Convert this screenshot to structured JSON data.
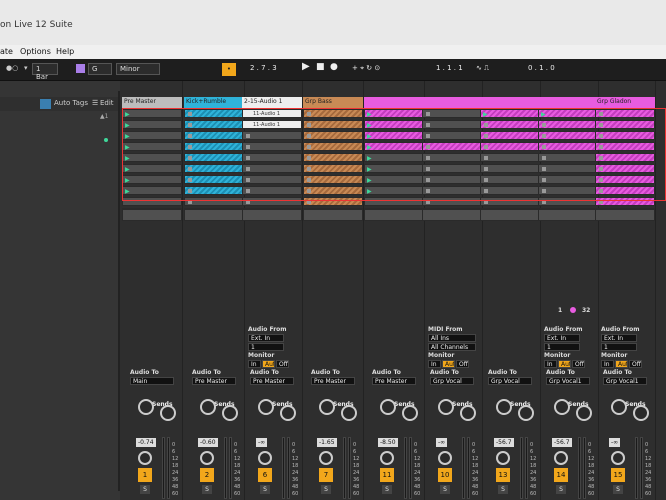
{
  "window": {
    "title": "on Live 12 Suite"
  },
  "menu": {
    "items": [
      "ate",
      "Options",
      "Help"
    ]
  },
  "control_bar": {
    "quantize": "1 Bar",
    "key": "G",
    "scale": "Minor",
    "arrangement_position": "2 . 7 . 3",
    "loop_start": "1 . 1 . 1",
    "loop_length": "0 . 1 . 0"
  },
  "browser": {
    "auto_tags": "Auto Tags",
    "edit": "Edit"
  },
  "tracks": [
    {
      "name": "Pre Master",
      "color": "#bdbdbd",
      "audio_to": "Main",
      "volume": "-0.74",
      "number": "1"
    },
    {
      "name": "Kick+Rumble",
      "color": "#2fb3d9",
      "audio_to": "Pre Master",
      "volume": "-0.60",
      "number": "2"
    },
    {
      "name": "2-15-Audio 1",
      "color": "#eeeeee",
      "audio_from_label": "Audio From",
      "audio_from": "Ext. In",
      "audio_from_ch": "1",
      "monitor_label": "Monitor",
      "monitor": [
        "In",
        "Auto",
        "Off"
      ],
      "audio_to": "Pre Master",
      "volume": "-∞",
      "number": "6"
    },
    {
      "name": "Grp Bass",
      "color": "#c98a55",
      "audio_to": "Pre Master",
      "volume": "-1.65",
      "number": "7"
    },
    {
      "name": "",
      "color": "#e85ce0",
      "audio_to": "Pre Master",
      "volume": "-8.50",
      "number": "11"
    },
    {
      "name": "",
      "color": "#e85ce0",
      "midi_from_label": "MIDI From",
      "midi_from": "All Ins",
      "midi_ch": "All Channels",
      "monitor_label": "Monitor",
      "monitor": [
        "In",
        "Auto",
        "Off"
      ],
      "audio_to": "Grp Vocal",
      "volume": "-∞",
      "number": "10"
    },
    {
      "name": "",
      "color": "#e85ce0",
      "audio_to": "Grp Vocal",
      "volume": "-56.7",
      "number": "13"
    },
    {
      "name": "",
      "color": "#e85ce0",
      "audio_from_label": "Audio From",
      "audio_from": "Ext. In",
      "audio_from_ch": "1",
      "monitor_label": "Monitor",
      "monitor": [
        "In",
        "Auto",
        "Off"
      ],
      "audio_to": "Grp Vocal1",
      "volume": "-56.7",
      "number": "14"
    },
    {
      "name": "Grp Gladon",
      "color": "#e85ce0",
      "audio_from_label": "Audio From",
      "audio_from": "Ext. In",
      "audio_from_ch": "1",
      "monitor_label": "Monitor",
      "monitor": [
        "In",
        "Auto",
        "Off"
      ],
      "audio_to": "Grp Vocal1",
      "volume": "-∞",
      "number": "15"
    }
  ],
  "clips_a": {
    "clip1": "11-Audio 1",
    "clip2": "11-Audio 1"
  },
  "labels": {
    "audio_to": "Audio To",
    "sends": "Sends",
    "solo": "S",
    "a": "A",
    "b": "B"
  },
  "pager": {
    "page": "1",
    "total": "32"
  },
  "meter_scale": [
    "0",
    "6",
    "12",
    "18",
    "24",
    "36",
    "48",
    "60"
  ]
}
